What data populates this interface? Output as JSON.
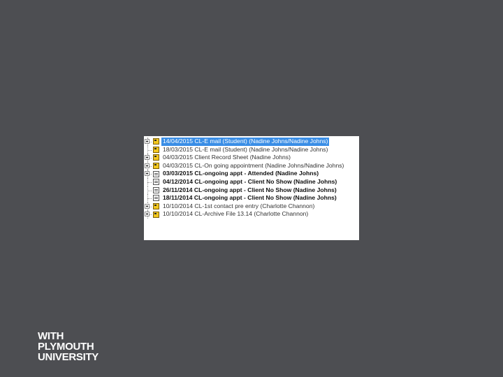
{
  "tree": {
    "items": [
      {
        "label": "14/04/2015 CL-E mail (Student) (Nadine Johns/Nadine Johns)",
        "icon": "folder-document-icon",
        "expandable": true,
        "selected": true,
        "bold": false
      },
      {
        "label": "18/03/2015 CL-E mail (Student) (Nadine Johns/Nadine Johns)",
        "icon": "folder-document-icon",
        "expandable": false,
        "selected": false,
        "bold": false
      },
      {
        "label": "04/03/2015 Client Record Sheet (Nadine Johns)",
        "icon": "folder-document-icon",
        "expandable": true,
        "selected": false,
        "bold": false
      },
      {
        "label": "04/03/2015 CL-On going appointment (Nadine Johns/Nadine Johns)",
        "icon": "folder-document-icon",
        "expandable": true,
        "selected": false,
        "bold": false
      },
      {
        "label": "03/03/2015 CL-ongoing appt - Attended (Nadine Johns)",
        "icon": "form-document-icon",
        "expandable": true,
        "selected": false,
        "bold": true
      },
      {
        "label": "04/12/2014 CL-ongoing appt - Client No Show (Nadine Johns)",
        "icon": "form-document-icon",
        "expandable": false,
        "selected": false,
        "bold": true
      },
      {
        "label": "26/11/2014 CL-ongoing appt - Client No Show (Nadine Johns)",
        "icon": "form-document-icon",
        "expandable": false,
        "selected": false,
        "bold": true
      },
      {
        "label": "18/11/2014 CL-ongoing appt - Client No Show (Nadine Johns)",
        "icon": "form-document-icon",
        "expandable": false,
        "selected": false,
        "bold": true
      },
      {
        "label": "10/10/2014 CL-1st contact pre entry (Charlotte Channon)",
        "icon": "folder-document-icon",
        "expandable": true,
        "selected": false,
        "bold": false
      },
      {
        "label": "10/10/2014 CL-Archive File 13.14 (Charlotte Channon)",
        "icon": "folder-document-icon",
        "expandable": true,
        "selected": false,
        "bold": false
      }
    ]
  },
  "logo": {
    "line1": "WITH",
    "line2": "PLYMOUTH",
    "line3": "UNIVERSITY"
  },
  "colors": {
    "background": "#4d4e52",
    "selection": "#3a8ee6",
    "panel": "#ffffff"
  }
}
